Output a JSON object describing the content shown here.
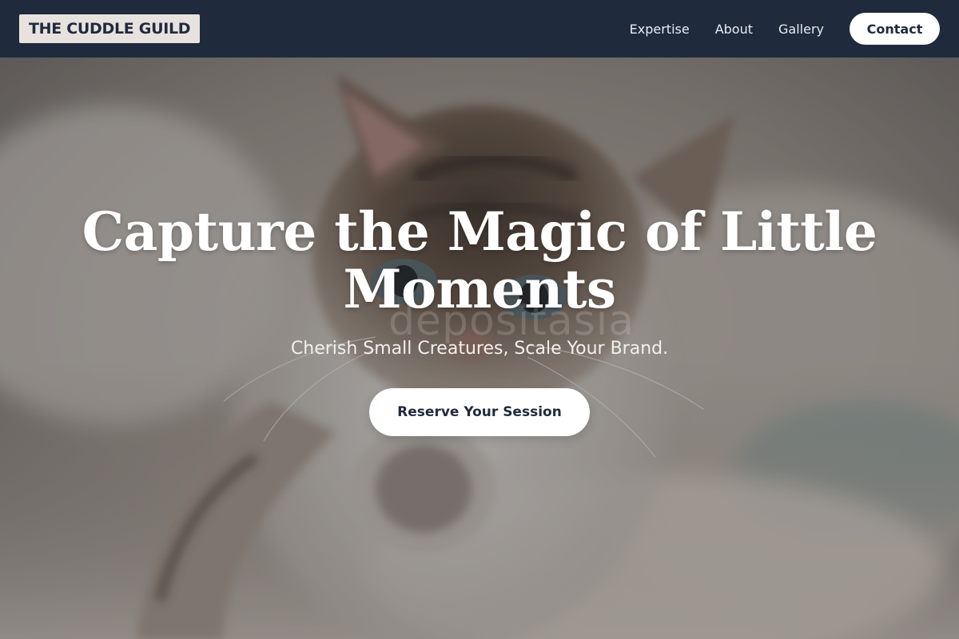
{
  "header": {
    "brand": "THE CUDDLE GUILD",
    "nav_links": [
      "Expertise",
      "About",
      "Gallery"
    ],
    "contact_label": "Contact"
  },
  "hero": {
    "image_subject": "kitten-photo",
    "title": "Capture the Magic of Little Moments",
    "watermark": "depositasia",
    "subtitle": "Cherish Small Creatures, Scale Your Brand.",
    "cta_label": "Reserve Your Session"
  },
  "colors": {
    "nav_background": "#1f2a3d",
    "brand_background": "#e8e2df",
    "button_background": "#ffffff",
    "button_text": "#1f2a3d",
    "hero_text": "#ffffff"
  }
}
